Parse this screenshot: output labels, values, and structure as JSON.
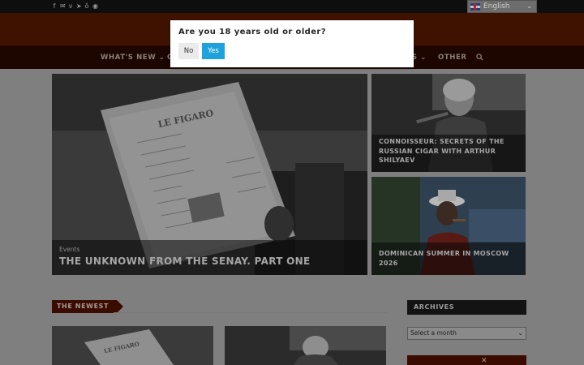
{
  "topbar": {
    "social_icons": [
      "facebook-icon",
      "email-icon",
      "vk-icon",
      "telegram-icon",
      "odnoklassniki-icon",
      "pinterest-icon"
    ],
    "language": "English"
  },
  "nav": {
    "items": [
      {
        "label": "WHAT'S NEW",
        "has_dropdown": true
      },
      {
        "label": "C"
      },
      {
        "label": "S",
        "has_dropdown": true
      },
      {
        "label": "OTHER"
      }
    ],
    "search_icon": "search-icon"
  },
  "featured": {
    "main": {
      "category": "Events",
      "title": "THE UNKNOWN FROM THE SENAY. PART ONE"
    },
    "side": [
      {
        "title": "CONNOISSEUR: SECRETS OF THE RUSSIAN CIGAR WITH ARTHUR SHILYAEV"
      },
      {
        "title": "DOMINICAN SUMMER IN MOSCOW 2026"
      }
    ]
  },
  "sections": {
    "newest": "THE NEWEST",
    "archives": "ARCHIVES",
    "month_select": "Select a month"
  },
  "modal": {
    "question": "Are you 18 years old or older?",
    "no": "No",
    "yes": "Yes"
  },
  "colors": {
    "brand_dark": "#3f1200",
    "nav_bg": "#1d0500",
    "yes_button": "#1ea2dc"
  }
}
